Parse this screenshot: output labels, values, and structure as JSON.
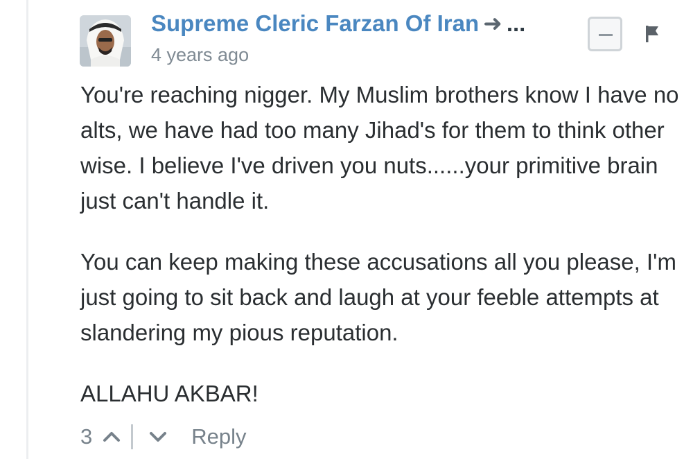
{
  "comment": {
    "author": "Supreme Cleric Farzan Of Iran",
    "reply_arrow": "➜",
    "more": "...",
    "timestamp": "4 years ago",
    "paragraphs": [
      "You're reaching nigger. My Muslim brothers know I have no alts, we have had too many Jihad's for them to think other wise. I believe I've driven you nuts......your primitive brain just can't handle it.",
      "You can keep making these accusations all you please, I'm just going to sit back and laugh at your feeble attempts at slandering my pious reputation.",
      "ALLAHU AKBAR!"
    ]
  },
  "footer": {
    "upvote_count": "3",
    "reply_label": "Reply"
  },
  "icons": {
    "avatar": "user-avatar",
    "upvote": "chevron-up-icon",
    "downvote": "chevron-down-icon",
    "collapse": "minus-icon",
    "flag": "flag-icon"
  }
}
